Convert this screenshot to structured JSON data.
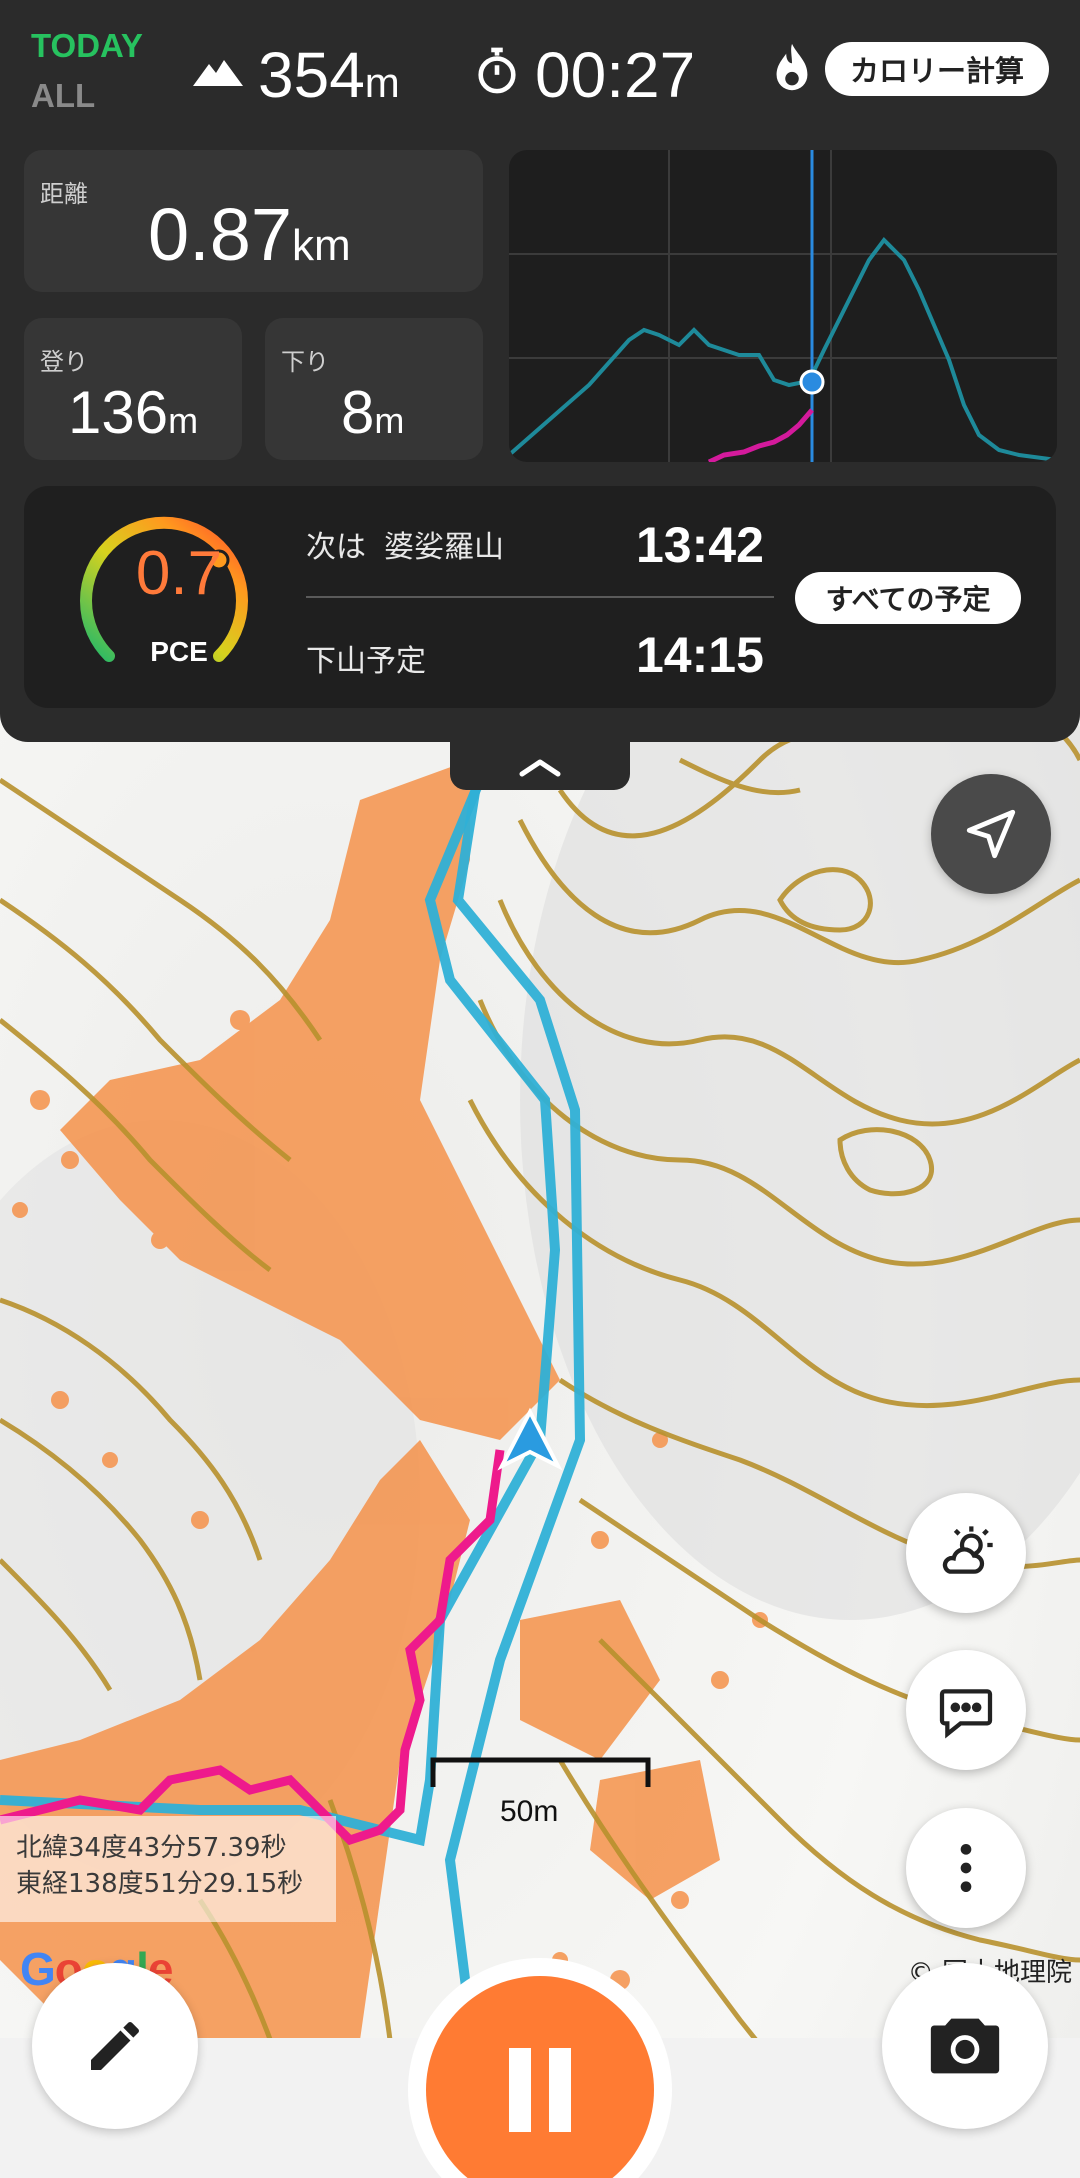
{
  "header": {
    "mode_today": "TODAY",
    "mode_all": "ALL",
    "altitude": {
      "value": "354",
      "unit": "m",
      "icon": "mountain-icon"
    },
    "elapsed": {
      "value": "00:27",
      "icon": "stopwatch-icon"
    },
    "calorie_button": {
      "label": "カロリー計算",
      "icon": "flame-icon"
    }
  },
  "stats": {
    "distance": {
      "label": "距離",
      "value": "0.87",
      "unit": "km"
    },
    "ascent": {
      "label": "登り",
      "value": "136",
      "unit": "m"
    },
    "descent": {
      "label": "下り",
      "value": "8",
      "unit": "m"
    }
  },
  "elevation_profile": {
    "planned_color": "#1e8a9a",
    "walked_color": "#d41a9c",
    "current_marker_color": "#2a8be0"
  },
  "plan": {
    "pce": {
      "value": "0.7",
      "label": "PCE",
      "gauge_fraction": 0.7
    },
    "next_prefix": "次は",
    "next_name": "婆娑羅山",
    "next_time": "13:42",
    "descent_label": "下山予定",
    "descent_time": "14:15",
    "all_plans_button": "すべての予定"
  },
  "map": {
    "scale_label": "50m",
    "coords": {
      "lat": "北緯34度43分57.39秒",
      "lon": "東経138度51分29.15秒"
    },
    "attribution": "© 国土地理院",
    "google_logo": "Google",
    "route_color": "#2fb0d6",
    "track_color": "#ee1a8c",
    "contour_color": "#b8912d",
    "vegetation_color": "#f5924a",
    "buttons": {
      "locate": "navigation-arrow-icon",
      "weather": "weather-sun-cloud-icon",
      "chat": "chat-bubble-icon",
      "more": "more-vertical-icon"
    }
  },
  "bottom": {
    "edit": "pencil-icon",
    "pause": "pause-icon",
    "camera": "camera-icon"
  }
}
